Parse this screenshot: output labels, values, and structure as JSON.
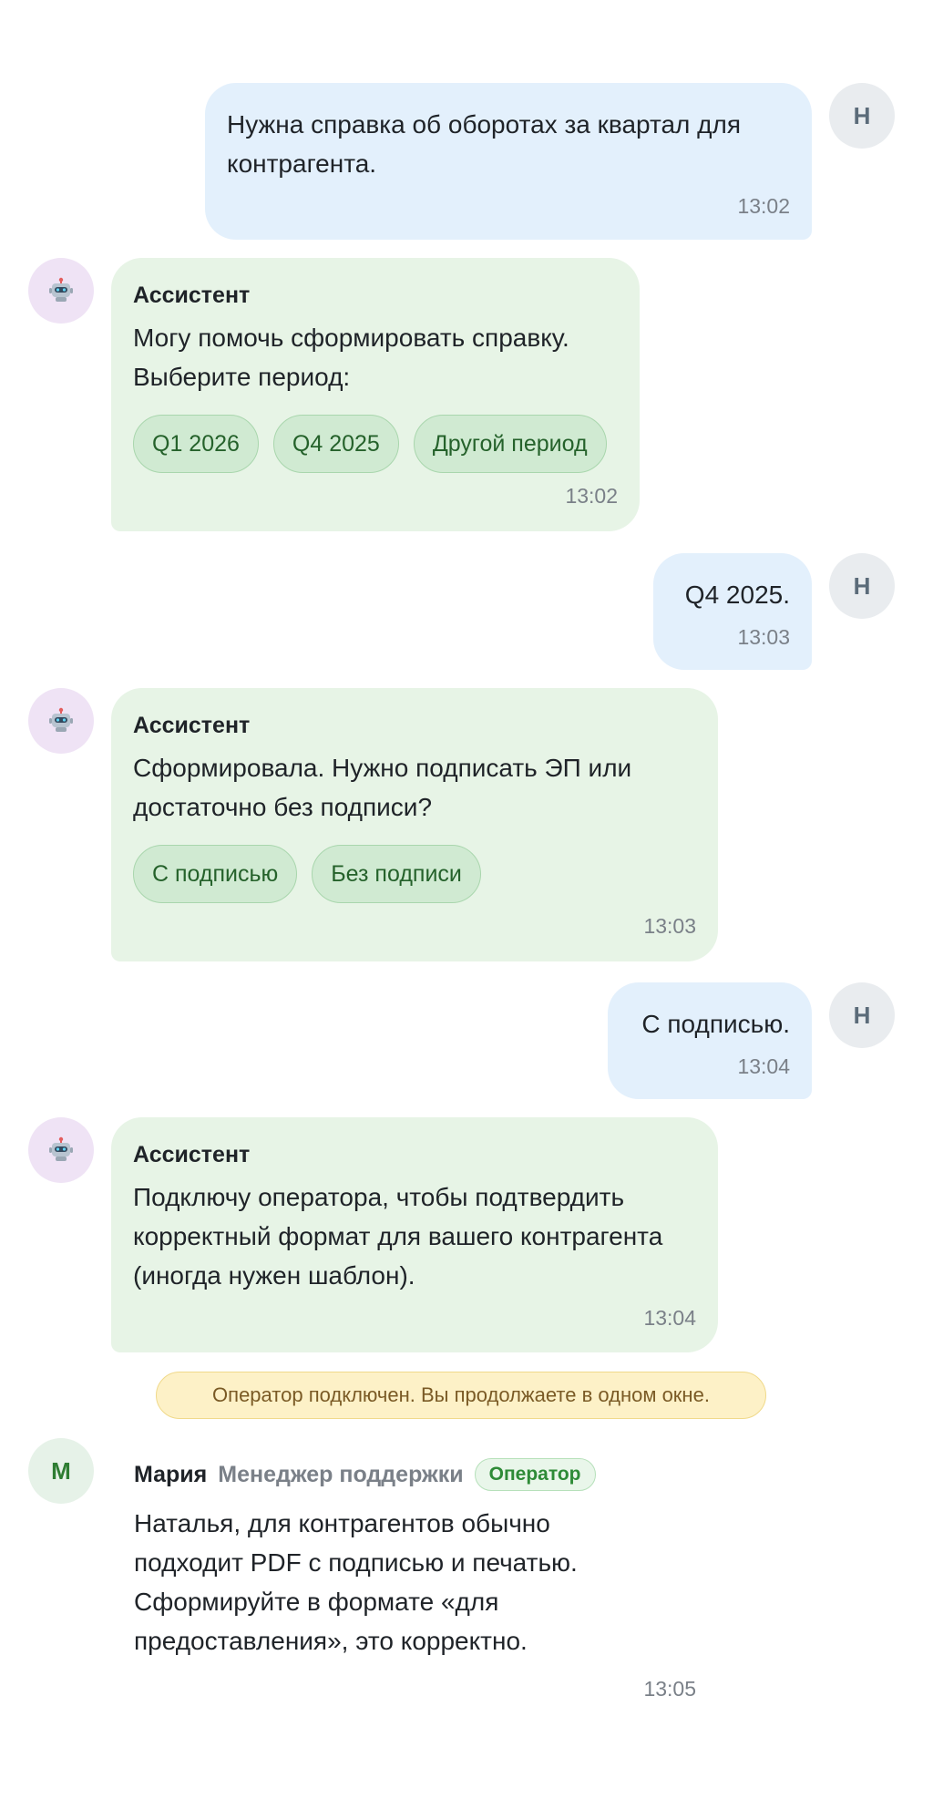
{
  "user_avatar": "Н",
  "operator_avatar": "М",
  "icons": {
    "bot_avatar": "robot-icon"
  },
  "colors": {
    "user_bubble": "#e3f0fc",
    "bot_bubble": "#e7f4e6",
    "chip": "#d0ead2",
    "notice": "#fdf1c7",
    "operator_badge": "#2e8b37"
  },
  "messages": [
    {
      "role": "user",
      "text": "Нужна справка об оборотах за квартал для контрагента.",
      "time": "13:02"
    },
    {
      "role": "assistant",
      "sender": "Ассистент",
      "text": "Могу помочь сформировать справку. Выберите период:",
      "chips": [
        "Q1 2026",
        "Q4 2025",
        "Другой период"
      ],
      "time": "13:02"
    },
    {
      "role": "user",
      "text": "Q4 2025.",
      "time": "13:03"
    },
    {
      "role": "assistant",
      "sender": "Ассистент",
      "text": "Сформировала. Нужно подписать ЭП или достаточно без подписи?",
      "chips": [
        "С подписью",
        "Без подписи"
      ],
      "time": "13:03"
    },
    {
      "role": "user",
      "text": "С подписью.",
      "time": "13:04"
    },
    {
      "role": "assistant",
      "sender": "Ассистент",
      "text": "Подключу оператора, чтобы подтвердить корректный формат для вашего контрагента (иногда нужен шаблон).",
      "time": "13:04"
    }
  ],
  "system_notice": "Оператор подключен. Вы продолжаете в одном окне.",
  "operator_message": {
    "name": "Мария",
    "role": "Менеджер поддержки",
    "badge": "Оператор",
    "text": "Наталья, для контрагентов обычно подходит PDF с подписью и печатью. Сформируйте в формате «для предоставления», это корректно.",
    "time": "13:05"
  }
}
